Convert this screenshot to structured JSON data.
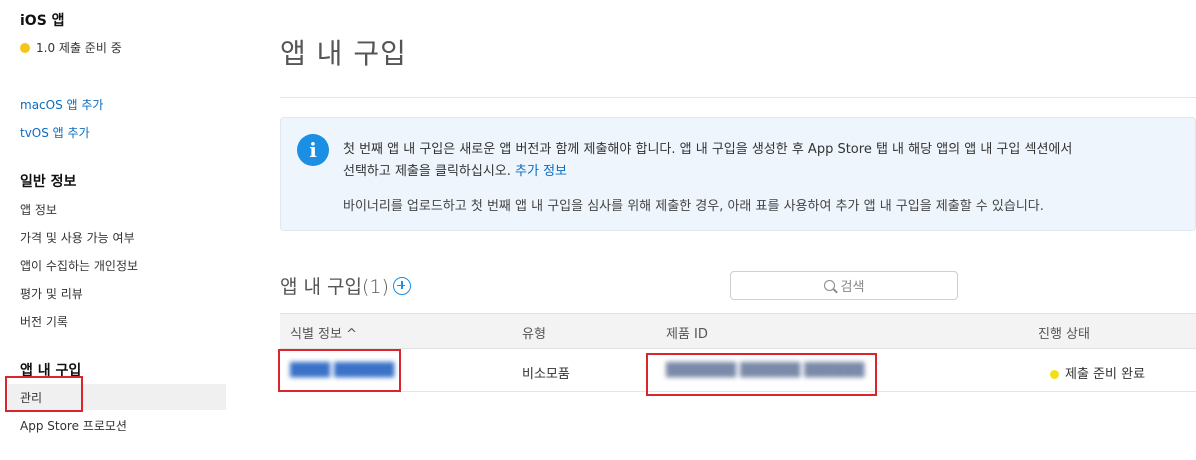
{
  "sidebar": {
    "app_title": "iOS 앱",
    "app_status": "1.0 제출 준비 중",
    "add_links": [
      "macOS 앱 추가",
      "tvOS 앱 추가"
    ],
    "general": {
      "heading": "일반 정보",
      "items": [
        "앱 정보",
        "가격 및 사용 가능 여부",
        "앱이 수집하는 개인정보",
        "평가 및 리뷰",
        "버전 기록"
      ]
    },
    "iap": {
      "heading": "앱 내 구입",
      "items": [
        "관리",
        "App Store 프로모션"
      ],
      "selected": "관리"
    }
  },
  "main": {
    "title": "앱 내 구입",
    "info": {
      "line1": "첫 번째 앱 내 구입은 새로운 앱 버전과 함께 제출해야 합니다. 앱 내 구입을 생성한 후 App Store 탭 내 해당 앱의 앱 내 구입 섹션에서",
      "line2": "선택하고 제출을 클릭하십시오.",
      "link": "추가 정보",
      "line3": "바이너리를 업로드하고 첫 번째 앱 내 구입을 심사를 위해 제출한 경우, 아래 표를 사용하여 추가 앱 내 구입을 제출할 수 있습니다."
    },
    "section_title": "앱 내 구입(1)",
    "search_placeholder": "검색",
    "table": {
      "headers": [
        "식별 정보 ^",
        "유형",
        "제품 ID",
        "진행 상태"
      ],
      "rows": [
        {
          "identifier": "████ ██████",
          "type": "비소모품",
          "product_id": "███████ ██████ ██████",
          "status": "제출 준비 완료"
        }
      ]
    }
  },
  "colors": {
    "link": "#0a6cc2",
    "accent": "#1a8fe3",
    "status_pending": "#f5c518",
    "status_ready": "#f0e015",
    "highlight": "#d8262c"
  }
}
